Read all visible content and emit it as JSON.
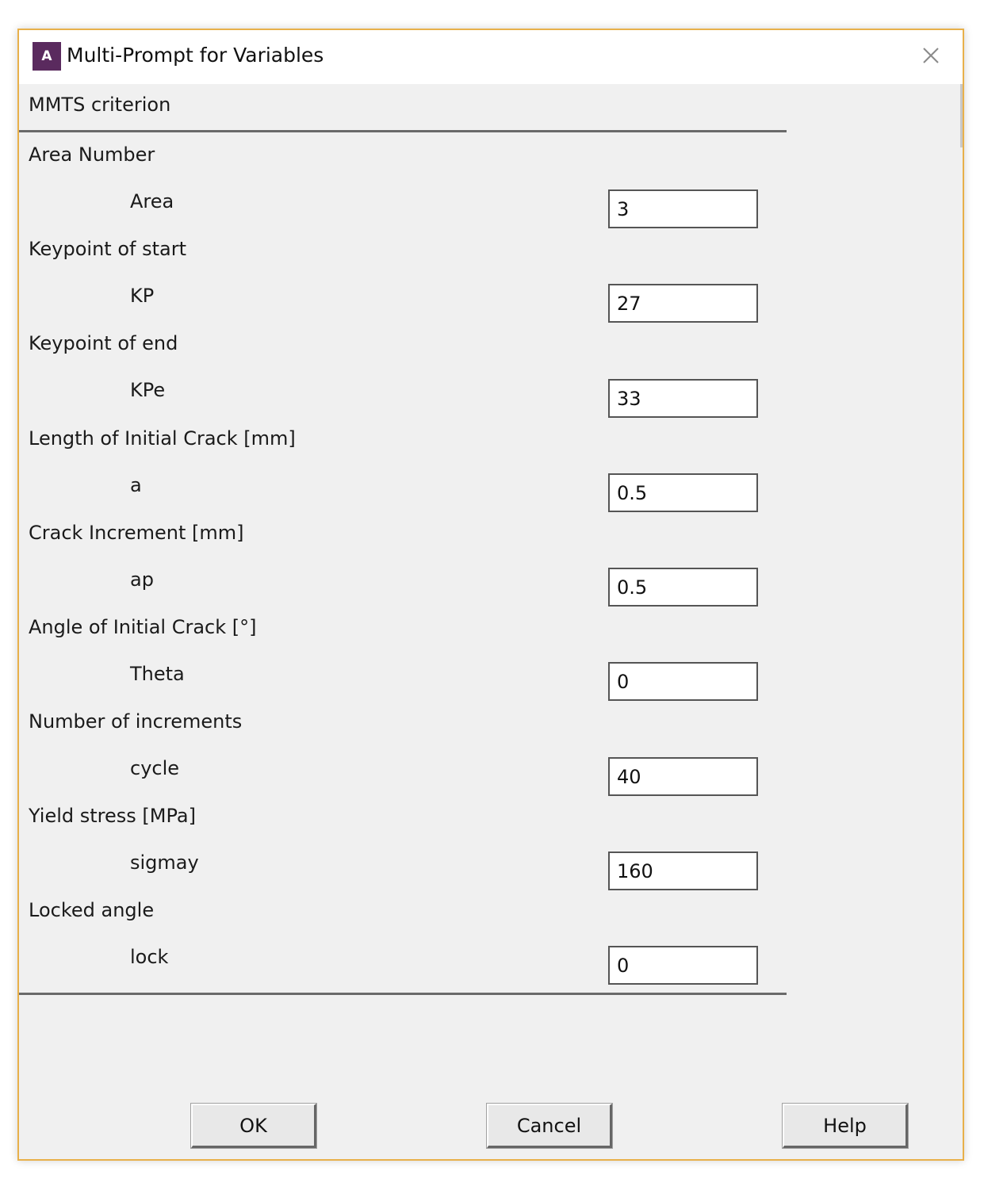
{
  "window": {
    "title": "Multi-Prompt for Variables",
    "icon_letter": "A",
    "icon_name": "ansys-app-icon",
    "close_icon": "close-icon"
  },
  "section": {
    "title": "MMTS criterion"
  },
  "prompts": [
    {
      "group": "Area Number",
      "var": "Area",
      "value": "3"
    },
    {
      "group": "Keypoint of start",
      "var": "KP",
      "value": "27"
    },
    {
      "group": "Keypoint of end",
      "var": "KPe",
      "value": "33"
    },
    {
      "group": "Length of Initial Crack [mm]",
      "var": "a",
      "value": "0.5"
    },
    {
      "group": "Crack Increment [mm]",
      "var": "ap",
      "value": "0.5"
    },
    {
      "group": "Angle of Initial Crack [°]",
      "var": "Theta",
      "value": "0"
    },
    {
      "group": "Number of increments",
      "var": "cycle",
      "value": "40"
    },
    {
      "group": "Yield stress [MPa]",
      "var": "sigmay",
      "value": "160"
    },
    {
      "group": "Locked angle",
      "var": "lock",
      "value": "0"
    }
  ],
  "buttons": {
    "ok": "OK",
    "cancel": "Cancel",
    "help": "Help"
  },
  "colors": {
    "border_accent": "#e8b04a",
    "dialog_bg": "#f0f0f0",
    "icon_bg": "#5a2a5e"
  }
}
